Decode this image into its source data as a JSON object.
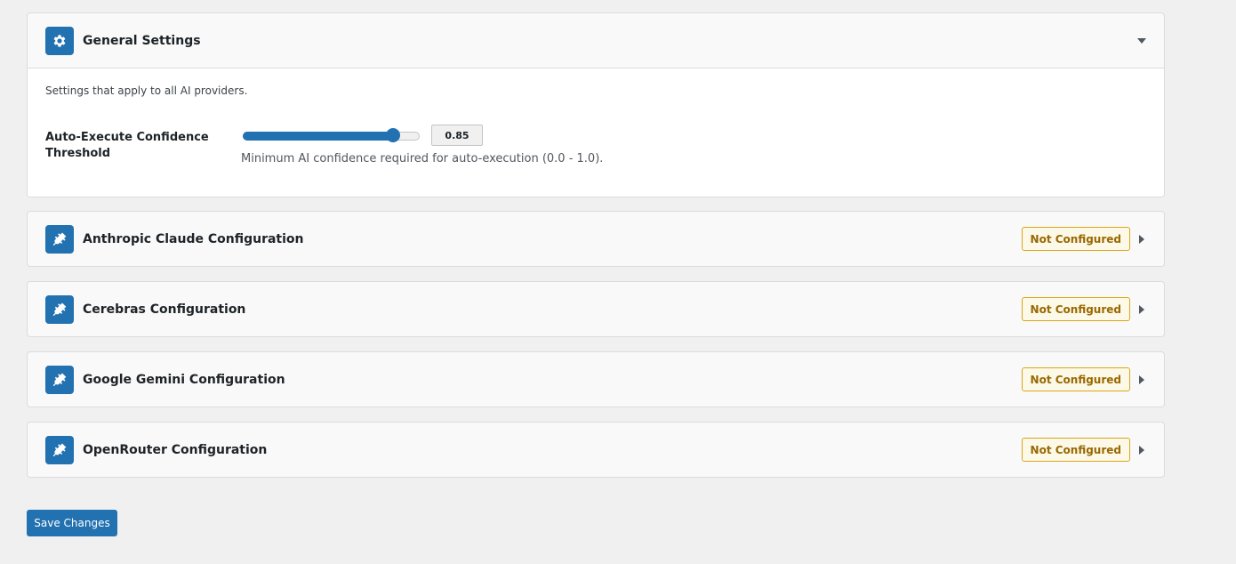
{
  "general": {
    "title": "General Settings",
    "icon": "gear-icon",
    "expanded": true,
    "description": "Settings that apply to all AI providers.",
    "threshold": {
      "label": "Auto-Execute Confidence Threshold",
      "value": "0.85",
      "fraction": 0.85,
      "hint": "Minimum AI confidence required for auto-execution (0.0 - 1.0)."
    }
  },
  "providers": [
    {
      "title": "Anthropic Claude Configuration",
      "status": "Not Configured",
      "icon": "plug-icon"
    },
    {
      "title": "Cerebras Configuration",
      "status": "Not Configured",
      "icon": "plug-icon"
    },
    {
      "title": "Google Gemini Configuration",
      "status": "Not Configured",
      "icon": "plug-icon"
    },
    {
      "title": "OpenRouter Configuration",
      "status": "Not Configured",
      "icon": "plug-icon"
    }
  ],
  "actions": {
    "save_label": "Save Changes"
  },
  "colors": {
    "accent": "#2271b1",
    "badge_border": "#dba617",
    "badge_text": "#996800"
  }
}
